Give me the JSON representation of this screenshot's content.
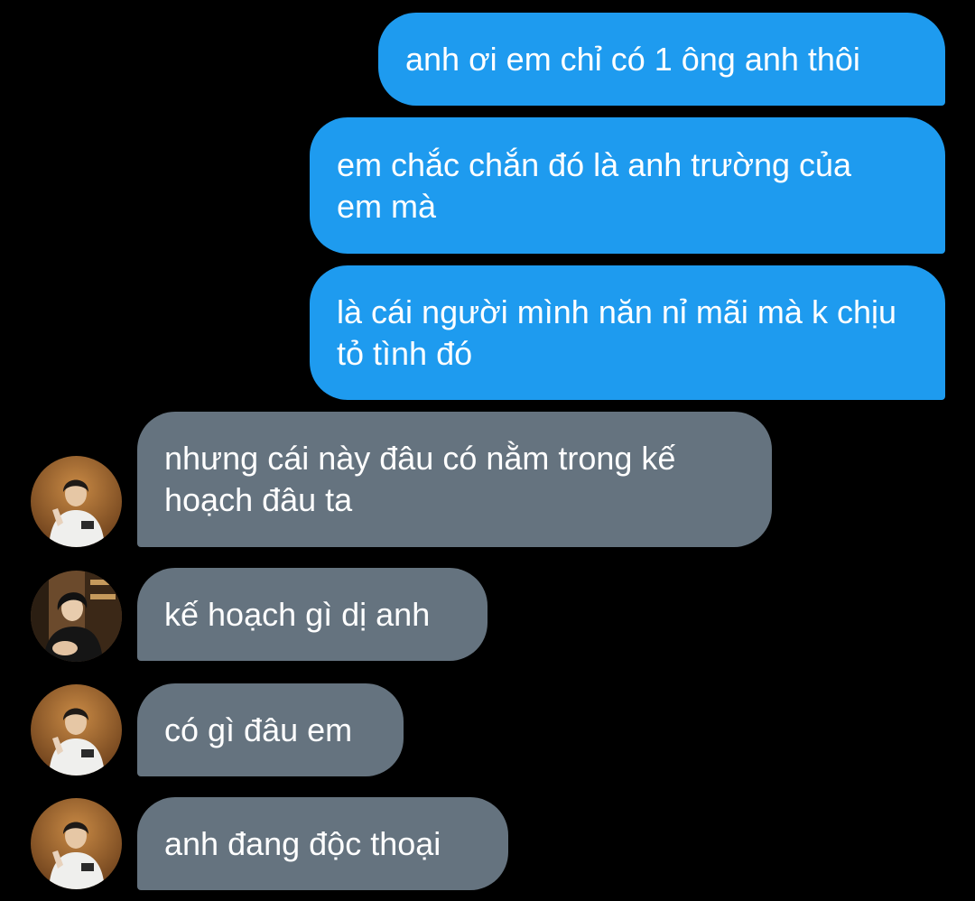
{
  "conversation": {
    "messages": [
      {
        "direction": "outgoing",
        "text": "anh ơi em chỉ có 1 ông anh thôi"
      },
      {
        "direction": "outgoing",
        "text": "em chắc chắn đó là anh trường của em mà"
      },
      {
        "direction": "outgoing",
        "text": "là cái người mình năn nỉ mãi mà k chịu tỏ tình đó"
      },
      {
        "direction": "incoming",
        "avatar": "avatar-photo-white-hoodie",
        "text": "nhưng cái này đâu có nằm trong kế hoạch đâu ta"
      },
      {
        "direction": "incoming",
        "avatar": "avatar-photo-dark-jacket",
        "text": "kế hoạch gì dị anh"
      },
      {
        "direction": "incoming",
        "avatar": "avatar-photo-white-hoodie",
        "text": "có gì đâu em"
      },
      {
        "direction": "incoming",
        "avatar": "avatar-photo-white-hoodie",
        "text": "anh đang độc thoại"
      }
    ]
  },
  "colors": {
    "background": "#000000",
    "outgoing_bubble": "#1e9bef",
    "incoming_bubble": "#65737f",
    "text": "#ffffff"
  }
}
